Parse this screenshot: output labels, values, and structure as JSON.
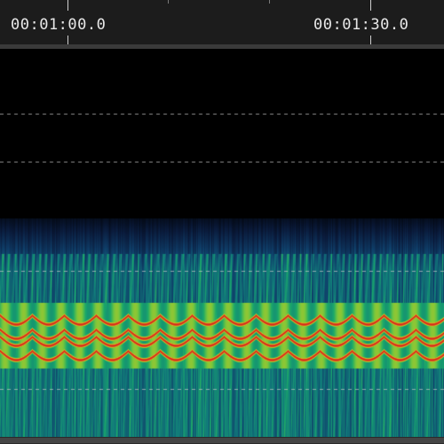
{
  "timeline": {
    "labels": [
      "00:01:00.0",
      "00:01:30.0"
    ]
  },
  "spectrogram": {
    "colormap": [
      "#000000",
      "#0a1a3a",
      "#0f3f6a",
      "#117a7a",
      "#1aa86a",
      "#7cc83a",
      "#d8c020",
      "#e26020",
      "#d01c1c"
    ],
    "grid_color": "#c8c8c8"
  }
}
